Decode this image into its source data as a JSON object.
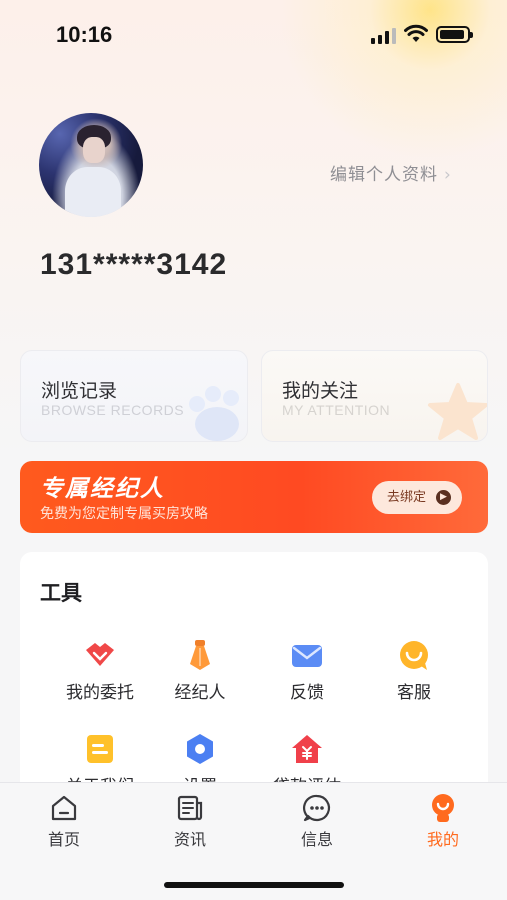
{
  "status_bar": {
    "time": "10:16"
  },
  "profile": {
    "edit_label": "编辑个人资料",
    "edit_chevron": "›",
    "phone": "131*****3142"
  },
  "quick_cards": [
    {
      "title": "浏览记录",
      "subtitle": "BROWSE RECORDS",
      "icon": "paw-icon"
    },
    {
      "title": "我的关注",
      "subtitle": "MY ATTENTION",
      "icon": "star-icon"
    }
  ],
  "banner": {
    "title": "专属经纪人",
    "subtitle": "免费为您定制专属买房攻略",
    "button": "去绑定",
    "color": "#ff5a1e"
  },
  "tools": {
    "title": "工具",
    "items": [
      {
        "label": "我的委托",
        "icon": "handshake-icon"
      },
      {
        "label": "经纪人",
        "icon": "agent-tie-icon"
      },
      {
        "label": "反馈",
        "icon": "envelope-icon"
      },
      {
        "label": "客服",
        "icon": "customer-service-icon"
      },
      {
        "label": "关于我们",
        "icon": "about-card-icon"
      },
      {
        "label": "设置",
        "icon": "settings-hexagon-icon"
      },
      {
        "label": "贷款评估",
        "icon": "loan-house-icon"
      }
    ]
  },
  "tabbar": {
    "items": [
      {
        "label": "首页",
        "icon": "home-icon",
        "active": false
      },
      {
        "label": "资讯",
        "icon": "news-icon",
        "active": false
      },
      {
        "label": "信息",
        "icon": "message-icon",
        "active": false
      },
      {
        "label": "我的",
        "icon": "profile-icon",
        "active": true
      }
    ],
    "active_color": "#ff6a1e"
  }
}
